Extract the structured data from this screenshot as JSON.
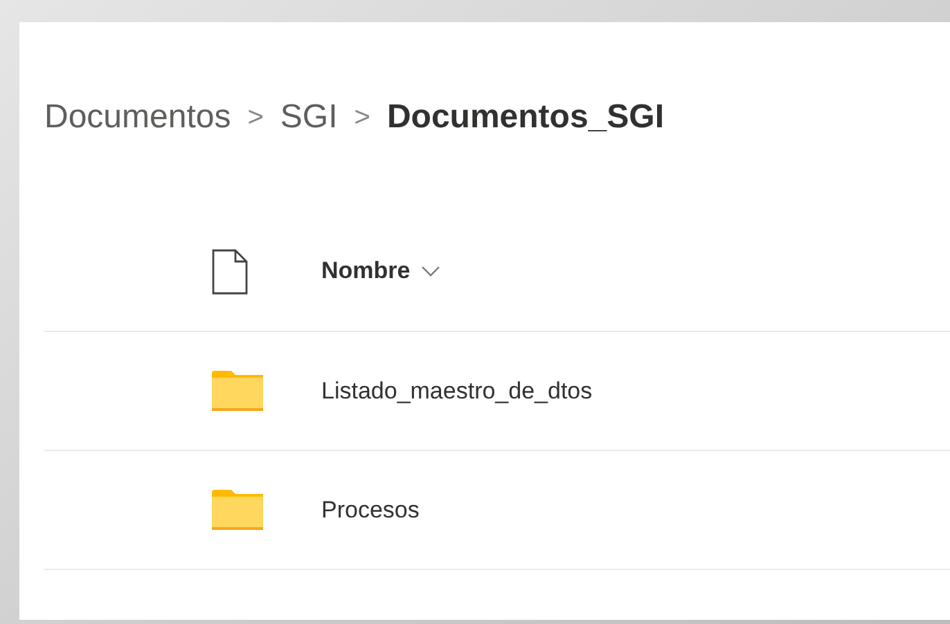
{
  "breadcrumb": [
    {
      "label": "Documentos",
      "current": false
    },
    {
      "label": "SGI",
      "current": false
    },
    {
      "label": "Documentos_SGI",
      "current": true
    }
  ],
  "breadcrumb_separator": ">",
  "table": {
    "columns": [
      {
        "label": "Nombre",
        "sortable": true
      }
    ],
    "rows": [
      {
        "name": "Listado_maestro_de_dtos",
        "kind": "folder"
      },
      {
        "name": "Procesos",
        "kind": "folder"
      }
    ]
  }
}
